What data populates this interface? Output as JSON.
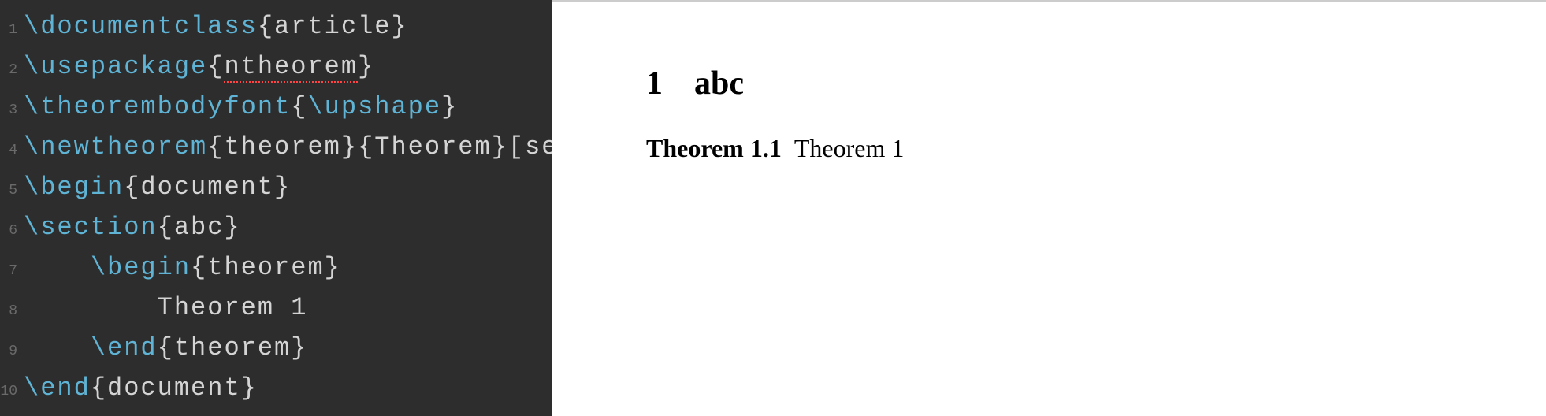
{
  "editor": {
    "lines": [
      {
        "num": "1",
        "tokens": [
          {
            "cls": "tok-command",
            "text": "\\documentclass"
          },
          {
            "cls": "tok-brace",
            "text": "{"
          },
          {
            "cls": "tok-arg",
            "text": "article"
          },
          {
            "cls": "tok-brace",
            "text": "}"
          }
        ]
      },
      {
        "num": "2",
        "tokens": [
          {
            "cls": "tok-command",
            "text": "\\usepackage"
          },
          {
            "cls": "tok-brace",
            "text": "{"
          },
          {
            "cls": "tok-arg spell-error",
            "text": "ntheorem"
          },
          {
            "cls": "tok-brace",
            "text": "}"
          }
        ]
      },
      {
        "num": "3",
        "tokens": [
          {
            "cls": "tok-command",
            "text": "\\theorembodyfont"
          },
          {
            "cls": "tok-brace",
            "text": "{"
          },
          {
            "cls": "tok-command",
            "text": "\\upshape"
          },
          {
            "cls": "tok-brace",
            "text": "}"
          }
        ]
      },
      {
        "num": "4",
        "tokens": [
          {
            "cls": "tok-command",
            "text": "\\newtheorem"
          },
          {
            "cls": "tok-brace",
            "text": "{"
          },
          {
            "cls": "tok-arg",
            "text": "theorem"
          },
          {
            "cls": "tok-brace",
            "text": "}{"
          },
          {
            "cls": "tok-arg",
            "text": "Theorem"
          },
          {
            "cls": "tok-brace",
            "text": "}["
          },
          {
            "cls": "tok-arg",
            "text": "section"
          },
          {
            "cls": "tok-brace",
            "text": "]"
          }
        ]
      },
      {
        "num": "5",
        "tokens": [
          {
            "cls": "tok-command",
            "text": "\\begin"
          },
          {
            "cls": "tok-brace",
            "text": "{"
          },
          {
            "cls": "tok-arg",
            "text": "document"
          },
          {
            "cls": "tok-brace",
            "text": "}"
          }
        ]
      },
      {
        "num": "6",
        "tokens": [
          {
            "cls": "tok-command",
            "text": "\\section"
          },
          {
            "cls": "tok-brace",
            "text": "{"
          },
          {
            "cls": "tok-arg",
            "text": "abc"
          },
          {
            "cls": "tok-brace",
            "text": "}"
          }
        ]
      },
      {
        "num": "7",
        "tokens": [
          {
            "cls": "tok-plain",
            "text": "    "
          },
          {
            "cls": "tok-command",
            "text": "\\begin"
          },
          {
            "cls": "tok-brace",
            "text": "{"
          },
          {
            "cls": "tok-arg",
            "text": "theorem"
          },
          {
            "cls": "tok-brace",
            "text": "}"
          }
        ]
      },
      {
        "num": "8",
        "tokens": [
          {
            "cls": "tok-plain",
            "text": "        Theorem 1"
          }
        ]
      },
      {
        "num": "9",
        "tokens": [
          {
            "cls": "tok-plain",
            "text": "    "
          },
          {
            "cls": "tok-command",
            "text": "\\end"
          },
          {
            "cls": "tok-brace",
            "text": "{"
          },
          {
            "cls": "tok-arg",
            "text": "theorem"
          },
          {
            "cls": "tok-brace",
            "text": "}"
          }
        ]
      },
      {
        "num": "10",
        "tokens": [
          {
            "cls": "tok-command",
            "text": "\\end"
          },
          {
            "cls": "tok-brace",
            "text": "{"
          },
          {
            "cls": "tok-arg",
            "text": "document"
          },
          {
            "cls": "tok-brace",
            "text": "}"
          }
        ]
      }
    ]
  },
  "preview": {
    "section_number": "1",
    "section_title": "abc",
    "theorem_label": "Theorem 1.1",
    "theorem_body": "Theorem 1"
  }
}
